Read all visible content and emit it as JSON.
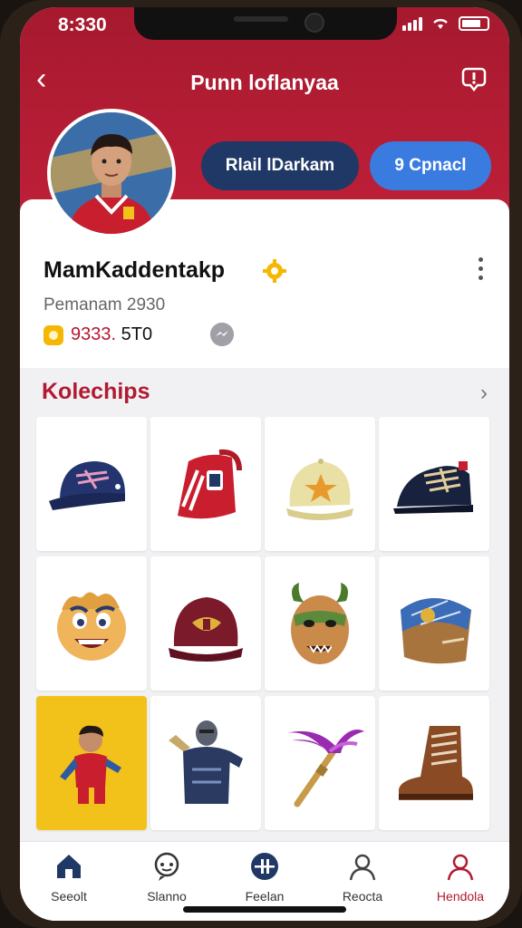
{
  "status_bar": {
    "time": "8:330"
  },
  "header": {
    "title": "Punn loflanyaa"
  },
  "actions": {
    "secondary_label": "Rlail lDarkam",
    "primary_label": "9 Cpnacl"
  },
  "profile": {
    "name": "MamKaddentakp",
    "subtitle": "Pemanam 2930",
    "coins_red": "9333.",
    "coins_rest": " 5T0"
  },
  "collection": {
    "title": "Kolechips",
    "items": [
      {
        "icon": "navy-baseball-cap-icon"
      },
      {
        "icon": "red-jersey-cap-icon"
      },
      {
        "icon": "star-cap-icon"
      },
      {
        "icon": "navy-boot-cap-icon"
      },
      {
        "icon": "cartoon-face-mask-icon"
      },
      {
        "icon": "maroon-cap-icon"
      },
      {
        "icon": "horned-mask-icon"
      },
      {
        "icon": "blue-bandana-icon"
      },
      {
        "icon": "player-figure-icon"
      },
      {
        "icon": "knight-jersey-icon"
      },
      {
        "icon": "feather-torch-icon"
      },
      {
        "icon": "brown-boot-icon"
      }
    ]
  },
  "nav": {
    "items": [
      {
        "label": "Seeolt",
        "icon": "home-icon"
      },
      {
        "label": "Slanno",
        "icon": "chat-face-icon"
      },
      {
        "label": "Feelan",
        "icon": "pause-circle-icon"
      },
      {
        "label": "Reocta",
        "icon": "person-icon"
      },
      {
        "label": "Hendola",
        "icon": "profile-icon"
      }
    ]
  },
  "colors": {
    "brand_red": "#b21a31",
    "accent_blue": "#3a7be0",
    "navy": "#1f3866"
  }
}
